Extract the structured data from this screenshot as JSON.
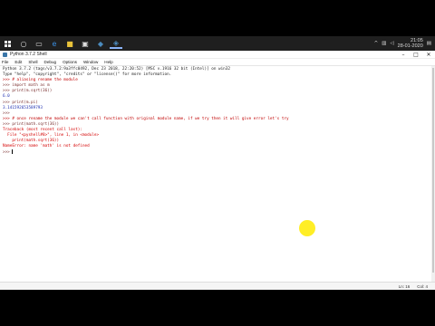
{
  "taskbar": {
    "clock_time": "21:05",
    "clock_date": "28-01-2020",
    "icons": [
      "windows-start",
      "cortana",
      "task-view",
      "edge",
      "file-explorer",
      "store",
      "python",
      "idle-shell"
    ]
  },
  "window": {
    "title": "Python 3.7.2 Shell",
    "menu": [
      "File",
      "Edit",
      "Shell",
      "Debug",
      "Options",
      "Window",
      "Help"
    ],
    "buttons": {
      "minimize": "–",
      "maximize": "□",
      "close": "✕"
    }
  },
  "shell": {
    "lines": [
      {
        "cls": "out",
        "text": "Python 3.7.2 (tags/v3.7.2:9a3ffc0492, Dec 23 2018, 22:20:52) [MSC v.1916 32 bit (Intel)] on win32"
      },
      {
        "cls": "out",
        "text": "Type \"help\", \"copyright\", \"credits\" or \"license()\" for more information."
      },
      {
        "cls": "comment",
        "text": ">>> # aliasing rename the module"
      },
      {
        "cls": "prompt",
        "text": ">>> import math as m"
      },
      {
        "cls": "prompt",
        "text": ">>> print(m.sqrt(36))"
      },
      {
        "cls": "num",
        "text": "6.0"
      },
      {
        "cls": "prompt",
        "text": ">>> print(m.pi)"
      },
      {
        "cls": "num",
        "text": "3.141592653589793"
      },
      {
        "cls": "prompt",
        "text": ">>>"
      },
      {
        "cls": "comment",
        "text": ">>> # once rename the module we can't call function with original module name, if we try then it will give error let's try"
      },
      {
        "cls": "prompt",
        "text": ">>> print(math.sqrt(36))"
      },
      {
        "cls": "err",
        "text": "Traceback (most recent call last):"
      },
      {
        "cls": "err",
        "text": "  File \"<pyshell#8>\", line 1, in <module>"
      },
      {
        "cls": "err",
        "text": "    print(math.sqrt(36))"
      },
      {
        "cls": "err",
        "text": "NameError: name 'math' is not defined"
      },
      {
        "cls": "prompt",
        "text": ">>> "
      }
    ]
  },
  "status": {
    "line": "Ln: 16",
    "col": "Col: 4"
  },
  "colors": {
    "error": "#d40000",
    "comment": "#c00000",
    "output_number": "#2030b0",
    "highlight": "#ffeb00"
  }
}
